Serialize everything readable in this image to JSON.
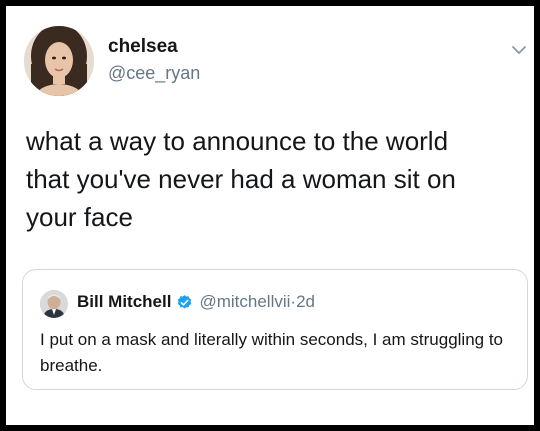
{
  "tweet": {
    "display_name": "chelsea",
    "handle": "@cee_ryan",
    "text": "what a way to announce to the world\nthat you've never had a woman sit on\nyour face"
  },
  "quoted_tweet": {
    "display_name": "Bill Mitchell",
    "handle": "@mitchellvii",
    "separator": " · ",
    "time": "2d",
    "text": "I put on a mask and literally within seconds, I am struggling to breathe.",
    "verified": true
  },
  "icons": {
    "more": "chevron-down-icon",
    "verified": "verified-badge-icon"
  },
  "colors": {
    "verified": "#1da1f2",
    "secondary_text": "#657786",
    "border": "#cfd9de"
  }
}
